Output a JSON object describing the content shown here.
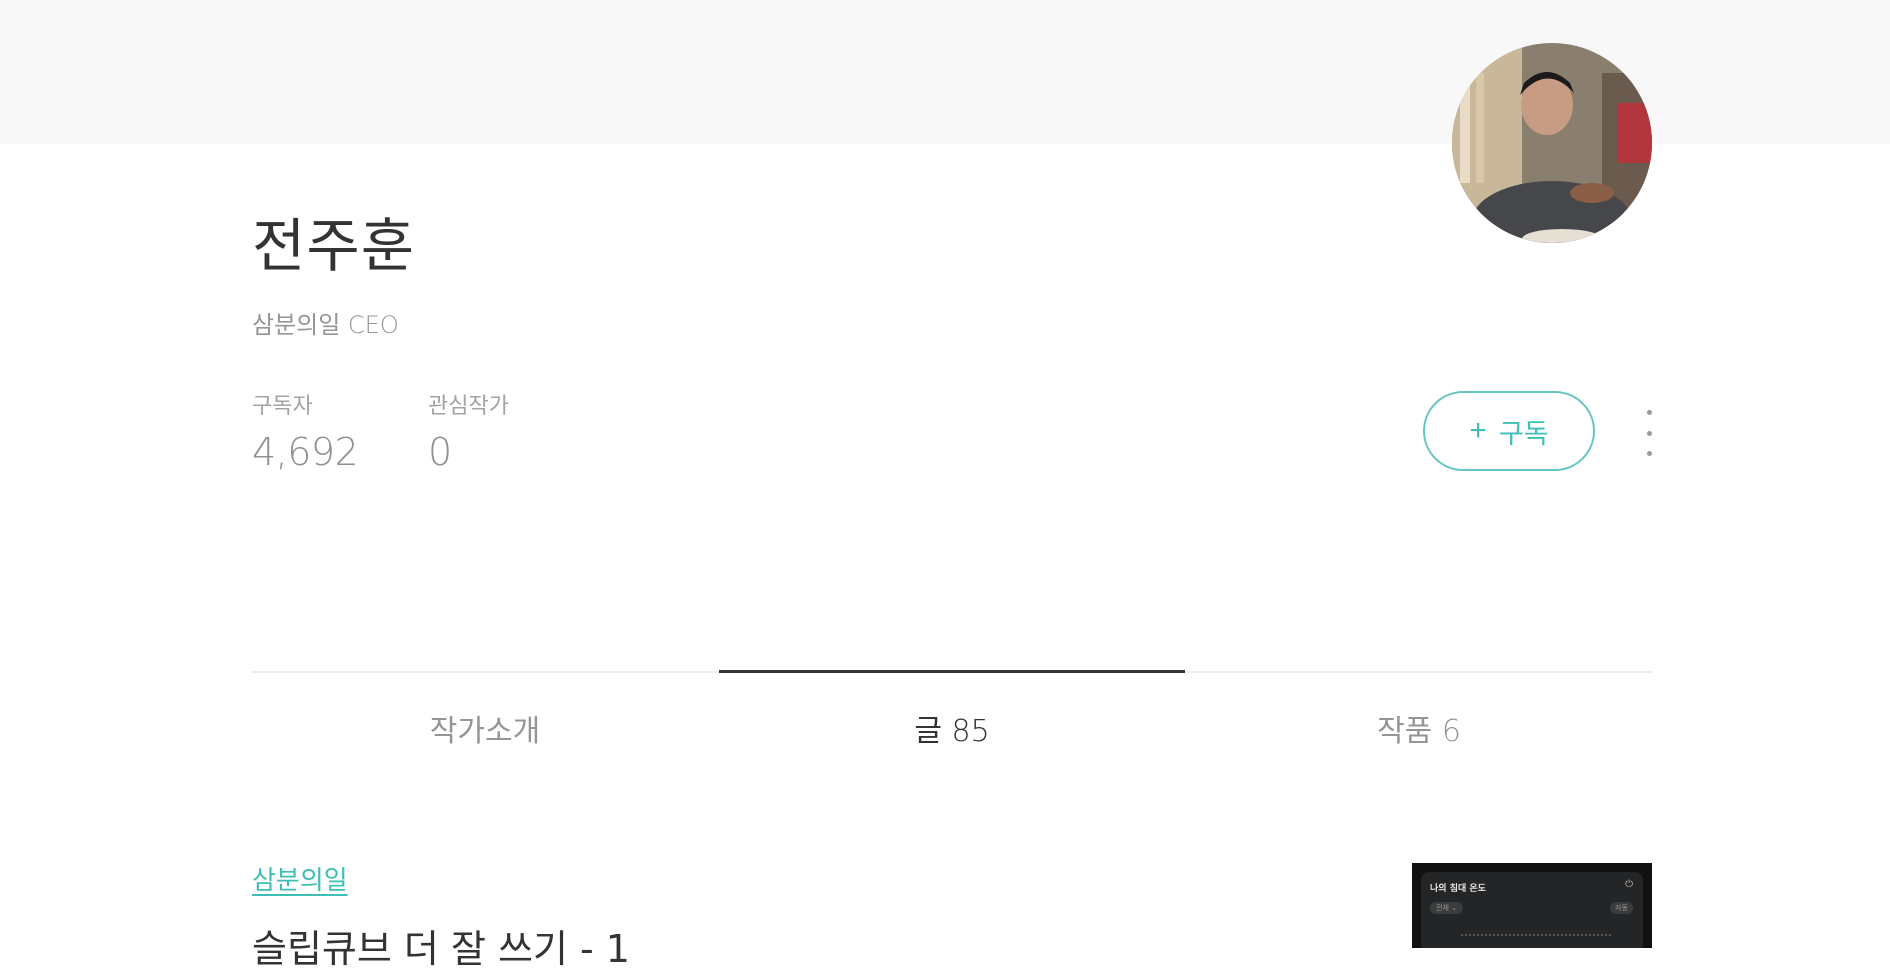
{
  "profile": {
    "name": "전주훈",
    "job": "삼분의일 CEO",
    "avatar_alt": "profile-photo"
  },
  "stats": {
    "subscribers_label": "구독자",
    "subscribers_value": "4,692",
    "following_label": "관심작가",
    "following_value": "0"
  },
  "actions": {
    "subscribe_plus": "+",
    "subscribe_label": "구독",
    "more_icon": "more-vertical-icon"
  },
  "tabs": [
    {
      "label": "작가소개",
      "active": false
    },
    {
      "label": "글 85",
      "active": true
    },
    {
      "label": "작품 6",
      "active": false
    }
  ],
  "post": {
    "category": "삼분의일",
    "title": "슬립큐브 더 잘 쓰기 - 1",
    "thumbnail": {
      "title": "나의 침대 온도",
      "chip": "전체 ⌄",
      "auto": "자동",
      "power_icon": "⏻"
    }
  },
  "colors": {
    "accent": "#3dbfb6",
    "cover_bg": "#f8f8f8",
    "text_dark": "#333333",
    "text_muted": "#959595"
  }
}
